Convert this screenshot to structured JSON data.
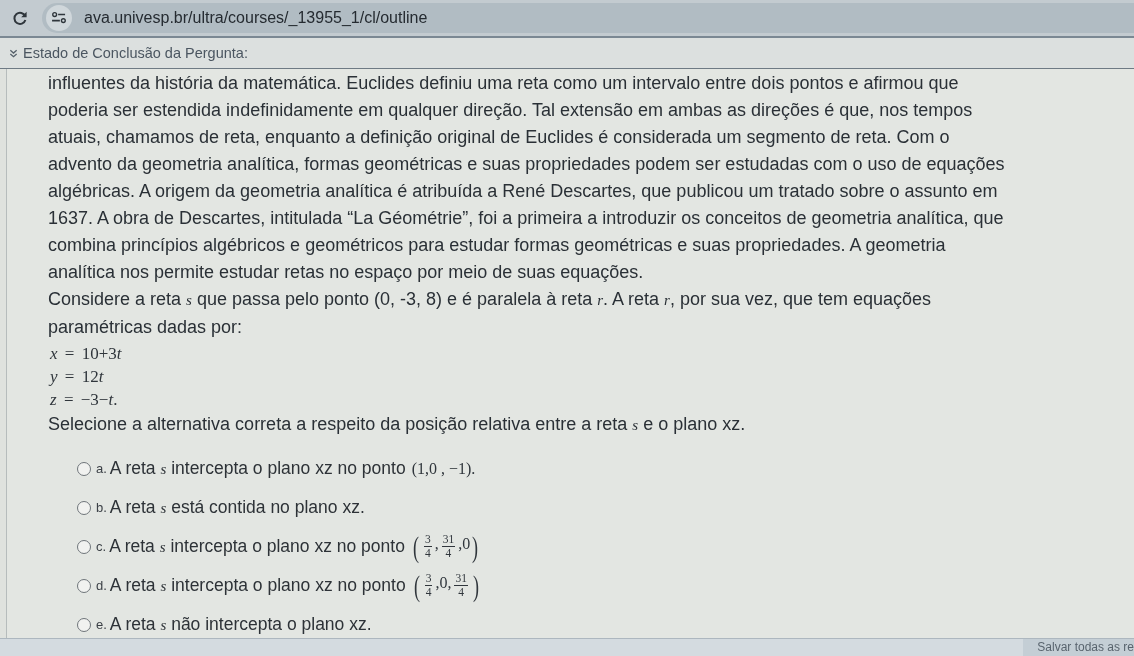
{
  "browser": {
    "url": "ava.univesp.br/ultra/courses/_13955_1/cl/outline"
  },
  "question_status": {
    "label": "Estado de Conclusão da Pergunta:"
  },
  "question": {
    "paragraphs": [
      "influentes da história da matemática. Euclides definiu uma reta como um intervalo entre dois pontos e afirmou que poderia ser estendida indefinidamente em qualquer direção. Tal extensão em ambas as direções é que, nos tempos atuais, chamamos de reta, enquanto a definição original de Euclides é considerada um segmento de reta. Com o advento da geometria analítica, formas geométricas e suas propriedades podem ser estudadas com o uso de equações algébricas. A origem da geometria analítica é atribuída a René Descartes, que publicou um tratado sobre o assunto em 1637. A obra de Descartes, intitulada “La Géométrie”, foi a primeira a introduzir os conceitos de geometria analítica, que combina princípios algébricos e geométricos para estudar formas geométricas e suas propriedades. A geometria analítica nos permite estudar retas no espaço por meio de suas equações.",
      "Considere a reta *s* que passa pelo ponto (0, -3, 8) e é paralela à reta *r*. A reta *r*, por sua vez, que tem equações paramétricas dadas por:"
    ],
    "equations": [
      {
        "parts": [
          {
            "kind": "var",
            "text": "x"
          },
          {
            "kind": "plain",
            "text": " = 10+3"
          },
          {
            "kind": "var",
            "text": "t"
          }
        ]
      },
      {
        "parts": [
          {
            "kind": "var",
            "text": "y"
          },
          {
            "kind": "plain",
            "text": " = 12"
          },
          {
            "kind": "var",
            "text": "t"
          }
        ]
      },
      {
        "parts": [
          {
            "kind": "var",
            "text": "z"
          },
          {
            "kind": "plain",
            "text": " = −3−"
          },
          {
            "kind": "var",
            "text": "t"
          },
          {
            "kind": "plain",
            "text": "."
          }
        ]
      }
    ],
    "prompt": "Selecione a alternativa correta a respeito da posição relativa entre a reta *s* e o plano xz."
  },
  "options": [
    {
      "letter": "a.",
      "text": "A reta *s* intercepta o plano xz no ponto",
      "selected": false,
      "math": [
        {
          "kind": "plain",
          "text": "(1,0 , −1)."
        }
      ]
    },
    {
      "letter": "b.",
      "text": "A reta *s* está contida no plano xz.",
      "selected": false
    },
    {
      "letter": "c.",
      "text": "A reta *s* intercepta o plano xz no ponto",
      "selected": false,
      "math": [
        {
          "kind": "paren",
          "text": "("
        },
        {
          "kind": "fraction",
          "numerator": "3",
          "denominator": "4"
        },
        {
          "kind": "plain",
          "text": ","
        },
        {
          "kind": "fraction",
          "numerator": "31",
          "denominator": "4"
        },
        {
          "kind": "plain",
          "text": ",0"
        },
        {
          "kind": "paren",
          "text": ")"
        }
      ]
    },
    {
      "letter": "d.",
      "text": "A reta *s* intercepta o plano xz no ponto",
      "selected": false,
      "math": [
        {
          "kind": "paren",
          "text": "("
        },
        {
          "kind": "fraction",
          "numerator": "3",
          "denominator": "4"
        },
        {
          "kind": "plain",
          "text": ",0,"
        },
        {
          "kind": "fraction",
          "numerator": "31",
          "denominator": "4"
        },
        {
          "kind": "paren",
          "text": ")"
        }
      ]
    },
    {
      "letter": "e.",
      "text": "A reta *s* não intercepta o plano xz.",
      "selected": false
    }
  ],
  "footer": {
    "save_button": "Salvar todas as re"
  }
}
